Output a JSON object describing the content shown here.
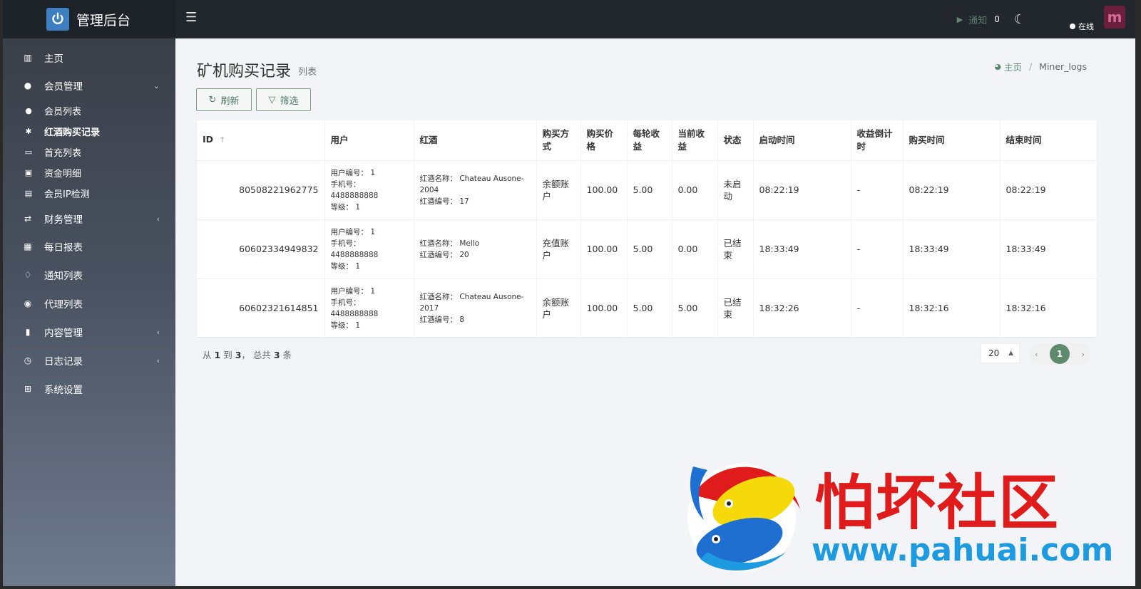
{
  "header": {
    "brand": "管理后台",
    "notify_label": "通知",
    "notify_count": "0",
    "status": "在线"
  },
  "sidebar": {
    "items": [
      {
        "label": "主页"
      },
      {
        "label": "会员管理"
      },
      {
        "label": "会员列表"
      },
      {
        "label": "红酒购买记录"
      },
      {
        "label": "首充列表"
      },
      {
        "label": "资金明细"
      },
      {
        "label": "会员IP检测"
      },
      {
        "label": "财务管理"
      },
      {
        "label": "每日报表"
      },
      {
        "label": "通知列表"
      },
      {
        "label": "代理列表"
      },
      {
        "label": "内容管理"
      },
      {
        "label": "日志记录"
      },
      {
        "label": "系统设置"
      }
    ]
  },
  "page": {
    "title": "矿机购买记录",
    "subtitle": "列表",
    "breadcrumb_home": "主页",
    "breadcrumb_current": "Miner_logs",
    "refresh_label": "刷新",
    "filter_label": "筛选"
  },
  "table": {
    "headers": [
      "ID",
      "用户",
      "红酒",
      "购买方式",
      "购买价格",
      "每轮收益",
      "当前收益",
      "状态",
      "启动时间",
      "收益倒计时",
      "购买时间",
      "结束时间"
    ],
    "rows": [
      {
        "id": "80508221962775",
        "user_no": "用户编号：  1",
        "phone": "手机号：",
        "phone_val": "4488888888",
        "level": "等级：  1",
        "wine_name": "红酒名称：  Chateau Ausone-2004",
        "wine_no": "红酒编号：  17",
        "method": "余额账户",
        "price": "100.00",
        "per_round": "5.00",
        "current": "0.00",
        "status": "未启动",
        "start": "08:22:19",
        "countdown": "-",
        "bought": "08:22:19",
        "end": "08:22:19"
      },
      {
        "id": "60602334949832",
        "user_no": "用户编号：  1",
        "phone": "手机号：",
        "phone_val": "4488888888",
        "level": "等级：  1",
        "wine_name": "红酒名称：  Mello",
        "wine_no": "红酒编号：  20",
        "method": "充值账户",
        "price": "100.00",
        "per_round": "5.00",
        "current": "0.00",
        "status": "已结束",
        "start": "18:33:49",
        "countdown": "-",
        "bought": "18:33:49",
        "end": "18:33:49"
      },
      {
        "id": "60602321614851",
        "user_no": "用户编号：  1",
        "phone": "手机号：",
        "phone_val": "4488888888",
        "level": "等级：  1",
        "wine_name": "红酒名称：  Chateau Ausone-2017",
        "wine_no": "红酒编号：  8",
        "method": "余额账户",
        "price": "100.00",
        "per_round": "5.00",
        "current": "5.00",
        "status": "已结束",
        "start": "18:32:26",
        "countdown": "-",
        "bought": "18:32:16",
        "end": "18:32:16"
      }
    ]
  },
  "footer": {
    "from_label": "从",
    "from": "1",
    "to_label": "到",
    "to": "3",
    "total_label": "，  总共",
    "total": "3",
    "unit": "条",
    "page_size": "20",
    "current_page": "1"
  },
  "watermark": {
    "text": "怕坏社区",
    "url": "www.pahuai.com"
  },
  "colors": {
    "accent": "#5f8a6e",
    "topbar": "#22262d",
    "watermark_red": "#e01b1b",
    "watermark_blue": "#1e9ae0"
  }
}
